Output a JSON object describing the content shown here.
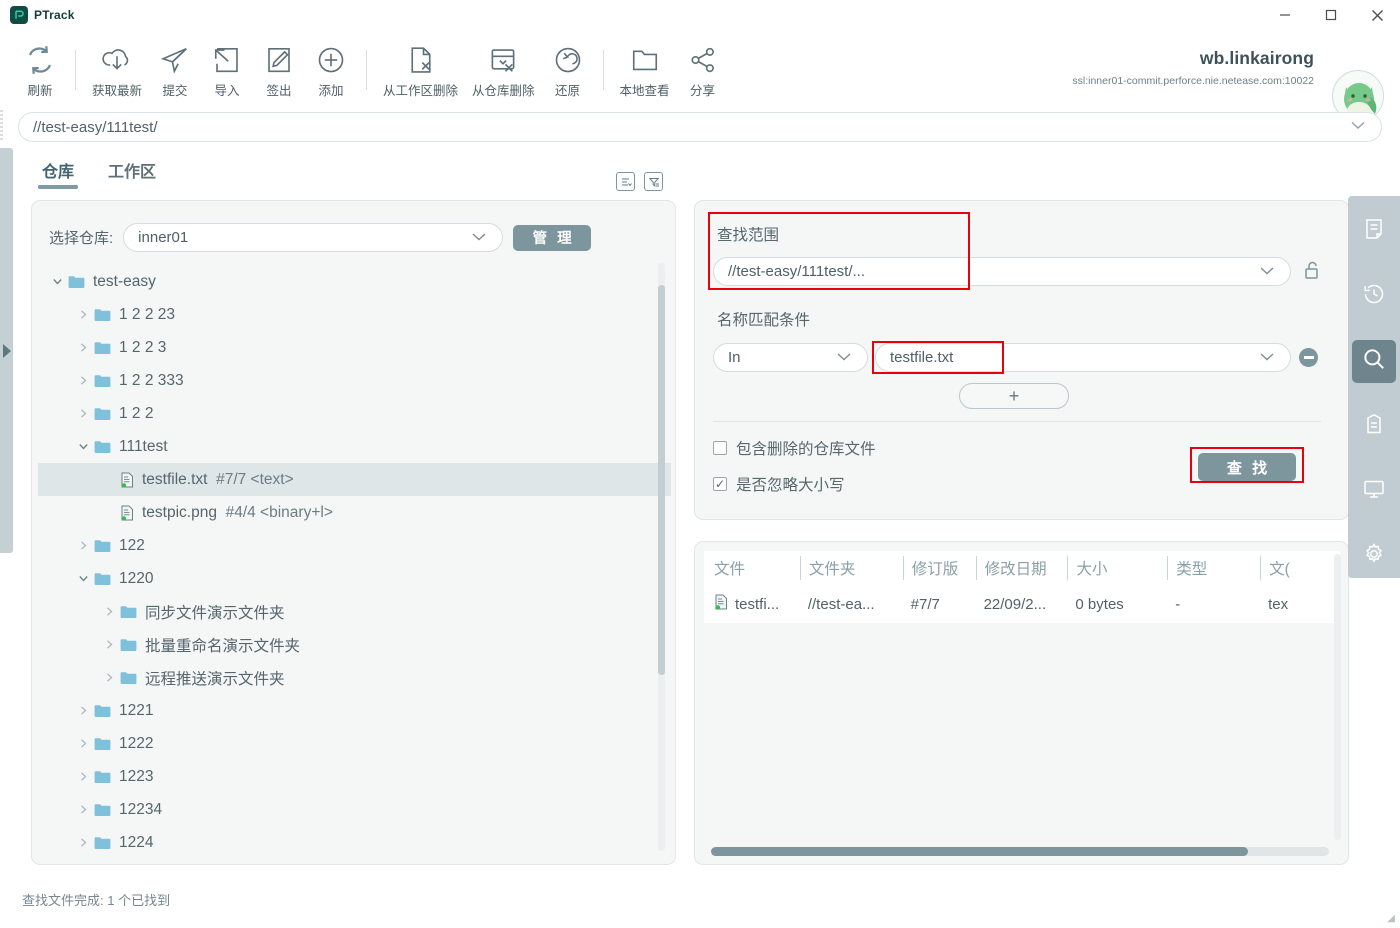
{
  "app": {
    "name": "PTrack",
    "logo_glyph": "P"
  },
  "window_controls": {
    "minimize": "–",
    "maximize": "◻",
    "close": "✕"
  },
  "toolbar": {
    "items": [
      {
        "label": "刷新",
        "icon": "refresh-icon"
      },
      {
        "label": "获取最新",
        "icon": "cloud-download-icon"
      },
      {
        "label": "提交",
        "icon": "paper-plane-icon"
      },
      {
        "label": "导入",
        "icon": "import-icon"
      },
      {
        "label": "签出",
        "icon": "edit-checkout-icon"
      },
      {
        "label": "添加",
        "icon": "plus-circle-icon"
      },
      {
        "label": "从工作区删除",
        "icon": "file-delete-icon"
      },
      {
        "label": "从仓库删除",
        "icon": "depot-delete-icon"
      },
      {
        "label": "还原",
        "icon": "revert-icon"
      },
      {
        "label": "本地查看",
        "icon": "folder-open-icon"
      },
      {
        "label": "分享",
        "icon": "share-icon"
      }
    ],
    "separators_after": [
      0,
      8
    ]
  },
  "user": {
    "name": "wb.linkairong",
    "server": "ssl:inner01-commit.perforce.nie.netease.com:10022",
    "avatar": "green-creature-avatar"
  },
  "path_bar": {
    "value": "//test-easy/111test/",
    "chevron": "⌄"
  },
  "tabs": {
    "items": [
      {
        "label": "仓库",
        "active": true
      },
      {
        "label": "工作区",
        "active": false
      }
    ],
    "icons": [
      {
        "name": "sort-list-icon"
      },
      {
        "name": "filter-icon"
      }
    ]
  },
  "left_panel": {
    "repo_label": "选择仓库:",
    "repo_value": "inner01",
    "manage_button": "管 理",
    "tree": [
      {
        "depth": 0,
        "chevron": "open",
        "type": "folder",
        "label": "test-easy"
      },
      {
        "depth": 1,
        "chevron": "closed",
        "type": "folder",
        "label": "1 2 2 23"
      },
      {
        "depth": 1,
        "chevron": "closed",
        "type": "folder",
        "label": "1 2 2 3"
      },
      {
        "depth": 1,
        "chevron": "closed",
        "type": "folder",
        "label": "1 2 2 333"
      },
      {
        "depth": 1,
        "chevron": "closed",
        "type": "folder",
        "label": "1 2 2"
      },
      {
        "depth": 1,
        "chevron": "open",
        "type": "folder",
        "label": "111test"
      },
      {
        "depth": 2,
        "chevron": "none",
        "type": "file",
        "label": "testfile.txt",
        "meta": "#7/7 <text>",
        "selected": true
      },
      {
        "depth": 2,
        "chevron": "none",
        "type": "file",
        "label": "testpic.png",
        "meta": "#4/4 <binary+l>"
      },
      {
        "depth": 1,
        "chevron": "closed",
        "type": "folder",
        "label": "122"
      },
      {
        "depth": 1,
        "chevron": "open",
        "type": "folder",
        "label": "1220"
      },
      {
        "depth": 2,
        "chevron": "closed",
        "type": "folder",
        "label": "同步文件演示文件夹"
      },
      {
        "depth": 2,
        "chevron": "closed",
        "type": "folder",
        "label": "批量重命名演示文件夹"
      },
      {
        "depth": 2,
        "chevron": "closed",
        "type": "folder",
        "label": "远程推送演示文件夹"
      },
      {
        "depth": 1,
        "chevron": "closed",
        "type": "folder",
        "label": "1221"
      },
      {
        "depth": 1,
        "chevron": "closed",
        "type": "folder",
        "label": "1222"
      },
      {
        "depth": 1,
        "chevron": "closed",
        "type": "folder",
        "label": "1223"
      },
      {
        "depth": 1,
        "chevron": "closed",
        "type": "folder",
        "label": "12234"
      },
      {
        "depth": 1,
        "chevron": "closed",
        "type": "folder",
        "label": "1224"
      }
    ]
  },
  "search_panel": {
    "scope_label": "查找范围",
    "scope_value": "//test-easy/111test/...",
    "lock_icon": "unlocked-padlock-icon",
    "match_label": "名称匹配条件",
    "match_operator": "In",
    "match_value": "testfile.txt",
    "remove_icon": "minus-circle-icon",
    "add_button": "+",
    "checkbox_deleted": {
      "label": "包含删除的仓库文件",
      "checked": false
    },
    "checkbox_ignorecase": {
      "label": "是否忽略大小写",
      "checked": true
    },
    "find_button": "查 找"
  },
  "results": {
    "columns": [
      "文件",
      "文件夹",
      "修订版",
      "修改日期",
      "大小",
      "类型",
      "文("
    ],
    "rows": [
      {
        "icon": "file-text-icon",
        "cells": [
          "testfi...",
          "//test-ea...",
          "#7/7",
          "22/09/2...",
          "0 bytes",
          "-",
          "tex"
        ]
      }
    ]
  },
  "rail": {
    "items": [
      {
        "name": "document-icon",
        "active": false
      },
      {
        "name": "history-clock-icon",
        "active": false
      },
      {
        "name": "search-icon",
        "active": true
      },
      {
        "name": "archive-box-icon",
        "active": false
      },
      {
        "name": "monitor-icon",
        "active": false
      },
      {
        "name": "gear-icon",
        "active": false
      }
    ]
  },
  "status_bar": {
    "text": "查找文件完成: 1 个已找到"
  },
  "colors": {
    "accent": "#7d959c",
    "panel_bg": "#f5f6f6",
    "highlight_red": "#e8000d",
    "folder_blue": "#7fc0db",
    "rail_bg": "#c0ccd1",
    "logo_dark": "#0d4d46"
  }
}
